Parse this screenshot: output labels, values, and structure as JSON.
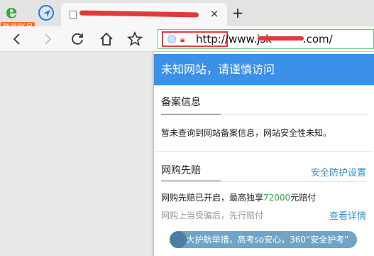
{
  "tabstrip": {
    "logo_letter": "e",
    "login_badge": "登录账号",
    "tab_title": "",
    "tab_close": "×",
    "new_tab": "+"
  },
  "toolbar": {
    "url": "http://www.jsk",
    "url_suffix": ".com/",
    "icons": [
      "back-icon",
      "forward-icon",
      "refresh-icon",
      "home-icon",
      "star-icon"
    ]
  },
  "panel": {
    "header": "未知网站，请谨慎访问",
    "record_section": {
      "title": "备案信息",
      "text": "暂未查询到网站备案信息，网站安全性未知。"
    },
    "compensation_section": {
      "title": "网购先赔",
      "settings_link": "安全防护设置",
      "line1_prefix": "网购先赔已开启，最高独享",
      "line1_amount": "72000",
      "line1_suffix": "元赔付",
      "line2": "网购上当受骗后，先行赔付",
      "details_link": "查看详情"
    },
    "promo": "五大护航举措，高考so安心，360“安全护考”"
  },
  "colors": {
    "header_blue": "#3b90ea",
    "link_blue": "#2e8fe0",
    "amount_green": "#23b43b",
    "badge_orange": "#ff6a2b"
  }
}
